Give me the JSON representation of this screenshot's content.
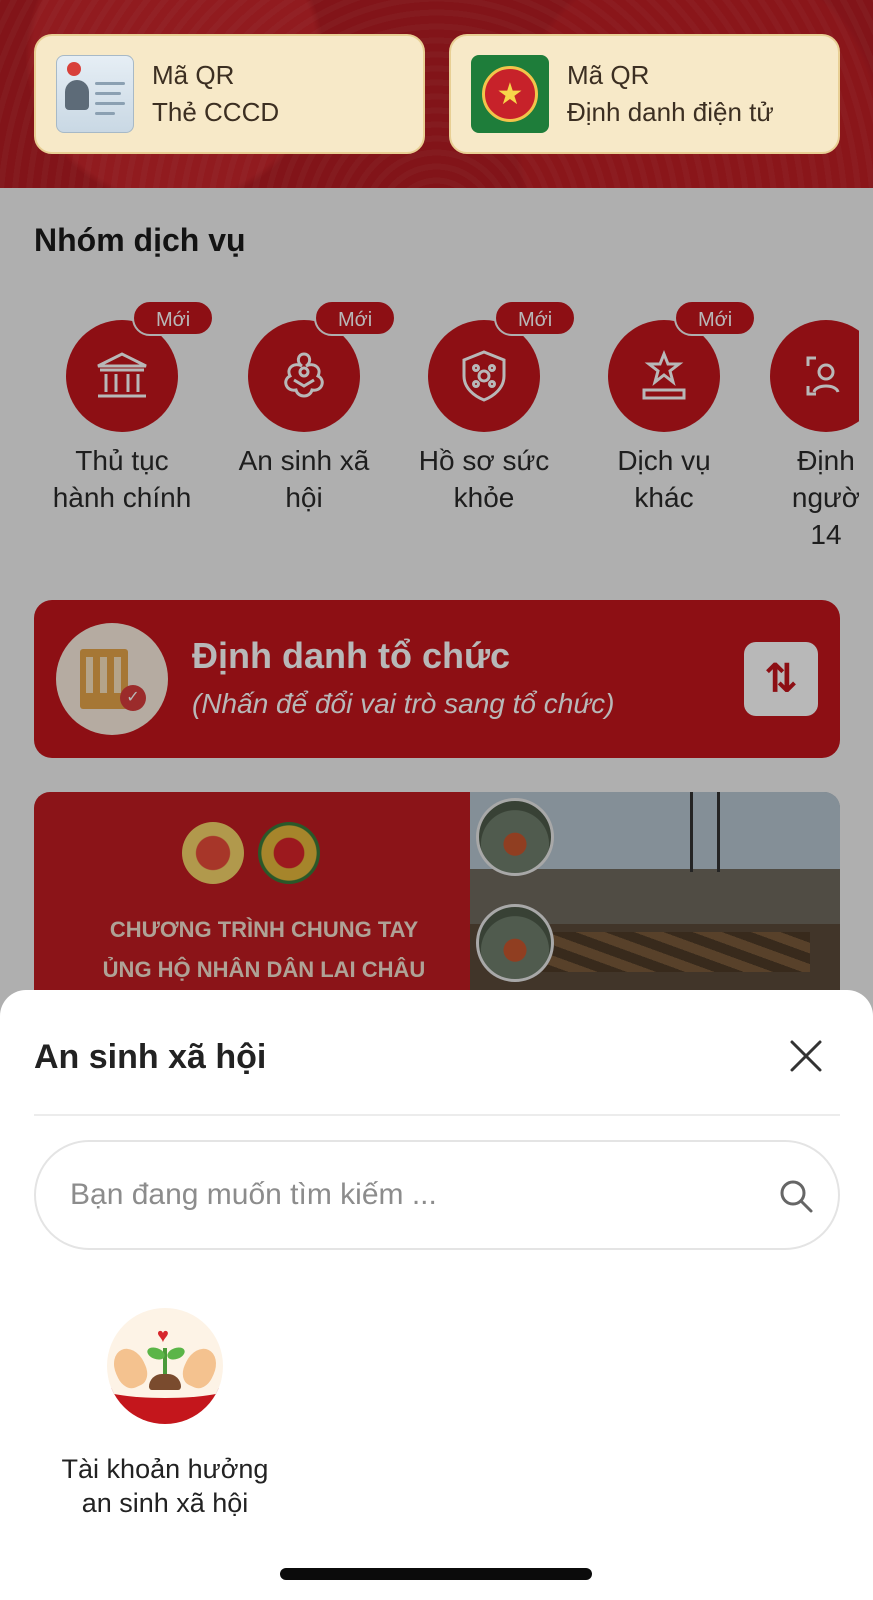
{
  "qr_cards": [
    {
      "line1": "Mã QR",
      "line2": "Thẻ CCCD",
      "icon": "id-card-icon"
    },
    {
      "line1": "Mã QR",
      "line2": "Định danh điện tử",
      "icon": "police-emblem-icon"
    }
  ],
  "service_group": {
    "title": "Nhóm dịch vụ",
    "new_badge": "Mới",
    "items": [
      {
        "label_line1": "Thủ tục",
        "label_line2": "hành chính",
        "icon": "government-building-icon",
        "is_new": true
      },
      {
        "label_line1": "An sinh xã",
        "label_line2": "hội",
        "icon": "social-welfare-icon",
        "is_new": true
      },
      {
        "label_line1": "Hồ sơ sức",
        "label_line2": "khỏe",
        "icon": "health-shield-icon",
        "is_new": true
      },
      {
        "label_line1": "Dịch vụ",
        "label_line2": "khác",
        "icon": "star-podium-icon",
        "is_new": true
      },
      {
        "label_line1": "Định",
        "label_line2": "ngườ",
        "label_line3": "14",
        "icon": "scan-person-icon",
        "is_new": false
      }
    ]
  },
  "org_banner": {
    "title": "Định danh tổ chức",
    "subtitle": "(Nhấn để đổi vai trò sang tổ chức)",
    "swap_symbol": "⇅"
  },
  "promo": {
    "line1": "CHƯƠNG TRÌNH CHUNG TAY",
    "line2": "ỦNG HỘ NHÂN DÂN LAI CHÂU"
  },
  "sheet": {
    "title": "An sinh xã hội",
    "search_placeholder": "Bạn đang muốn tìm kiếm ...",
    "items": [
      {
        "label_line1": "Tài khoản hưởng",
        "label_line2": "an sinh xã hội",
        "icon": "seedling-hands-icon"
      }
    ]
  },
  "colors": {
    "brand_red": "#c4161c",
    "card_cream": "#f7e9c8",
    "sheet_bg": "#ffffff"
  }
}
